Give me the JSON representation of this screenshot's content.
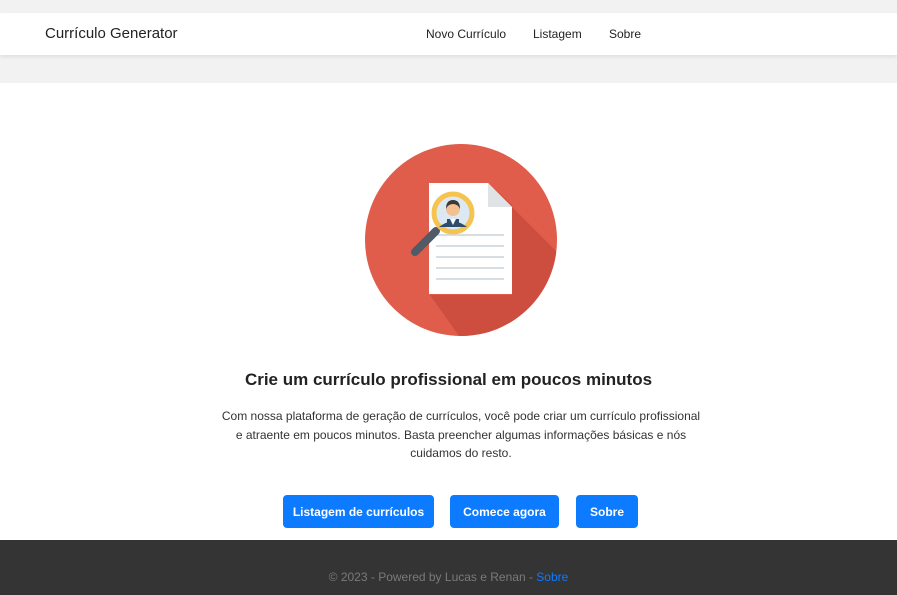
{
  "navbar": {
    "brand": "Currículo Generator",
    "links": [
      "Novo Currículo",
      "Listagem",
      "Sobre"
    ]
  },
  "hero": {
    "title": "Crie um currículo profissional em poucos minutos",
    "description": "Com nossa plataforma de geração de currículos, você pode criar um currículo profissional e atraente em poucos minutos. Basta preencher algumas informações básicas e nós cuidamos do resto.",
    "buttons": [
      "Listagem de currículos",
      "Comece agora",
      "Sobre"
    ]
  },
  "footer": {
    "text": "© 2023 - Powered by Lucas e Renan - ",
    "link": "Sobre"
  },
  "colors": {
    "accent": "#0d7bff",
    "illustration_bg": "#e05c4b",
    "footer_bg": "#343434"
  }
}
